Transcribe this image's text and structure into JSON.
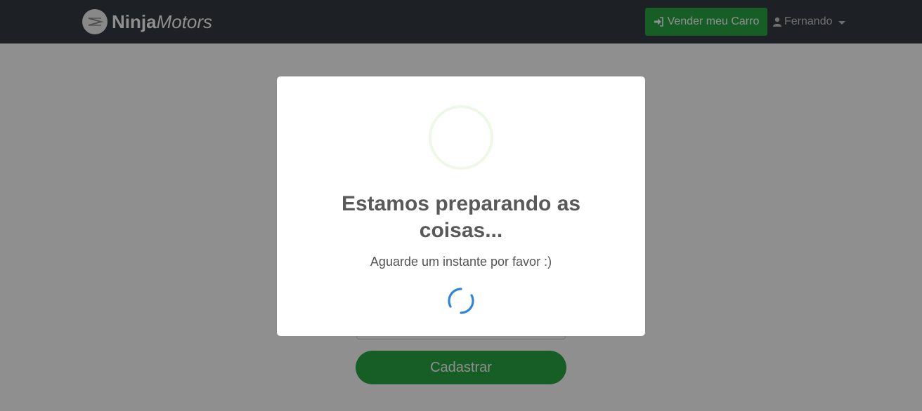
{
  "navbar": {
    "brand": {
      "strong": "Ninja",
      "em": "Motors"
    },
    "sell_button": {
      "label": "Vender meu Carro",
      "icon": "sign-in-icon"
    },
    "user_menu": {
      "name": "Fernando",
      "icon": "user-icon"
    }
  },
  "form": {
    "submit_label": "Cadastrar"
  },
  "modal": {
    "icon": "success-ring-icon",
    "title": "Estamos preparando as coisas...",
    "text": "Aguarde um instante por favor :)",
    "loader": "loading-spinner-icon"
  },
  "colors": {
    "navbar_bg": "#343a40",
    "accent_green": "#28a745",
    "spinner_blue": "#3085d6",
    "overlay": "rgba(0,0,0,0.44)"
  }
}
